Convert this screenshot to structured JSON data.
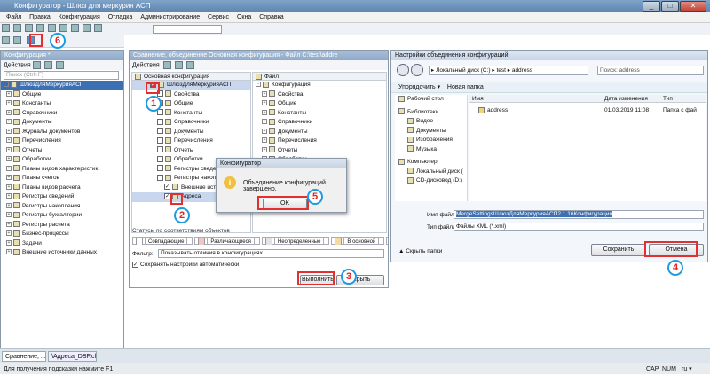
{
  "app": {
    "title": "Конфигуратор - Шлюз для меркурия АСП",
    "win_min": "_",
    "win_max": "□",
    "win_close": "✕"
  },
  "menu": [
    "Файл",
    "Правка",
    "Конфигурация",
    "Отладка",
    "Администрирование",
    "Сервис",
    "Окна",
    "Справка"
  ],
  "left_panel": {
    "title": "Конфигурация *",
    "actions": "Действия",
    "search_placeholder": "Поиск (Ctrl+F)",
    "root": "ШлюзДляМеркурияАСП",
    "items": [
      "Общие",
      "Константы",
      "Справочники",
      "Документы",
      "Журналы документов",
      "Перечисления",
      "Отчеты",
      "Обработки",
      "Планы видов характеристик",
      "Планы счетов",
      "Планы видов расчета",
      "Регистры сведений",
      "Регистры накопления",
      "Регистры бухгалтерии",
      "Регистры расчета",
      "Бизнес-процессы",
      "Задачи",
      "Внешние источники данных"
    ]
  },
  "compare": {
    "title": "Сравнение, объединение Основная конфигурация - Файл C:\\test\\addre",
    "actions": "Действия",
    "col_main": "Основная конфигурация",
    "col_file": "Файл",
    "main_root": "ШлюзДляМеркурияАСП",
    "main_items": [
      "Свойства",
      "Общие",
      "Константы",
      "Справочники",
      "Документы",
      "Перечисления",
      "Отчеты",
      "Обработки",
      "Регистры сведен",
      "Регистры накоп",
      "Внешние ист",
      "Адреса"
    ],
    "file_root": "Конфигурация",
    "file_items": [
      "Свойства",
      "Общие",
      "Константы",
      "Справочники",
      "Документы",
      "Перечисления",
      "Отчеты",
      "Обработки",
      "Регистры сведений",
      "Регистры накоплен"
    ],
    "statuses_label": "Статусы по соответствиям объектов",
    "legend": [
      "Совпадающие",
      "Различающиеся",
      "Неопределенные",
      "В основной",
      "Нет порядок"
    ],
    "legend_colors": [
      "#ffffff",
      "#f1c5c5",
      "#e3e3e3",
      "#f5d9a6",
      "#c9e8c2"
    ],
    "filter_label": "Фильтр:",
    "filter_value": "Показывать отличия в конфигурациях",
    "save_settings": "Сохранять настройки автоматически",
    "execute_btn": "Выполнить",
    "close_btn": "акрыть"
  },
  "msgbox": {
    "title": "Конфигуратор",
    "text": "Объединение конфигураций завершено.",
    "ok": "OK"
  },
  "save_dialog": {
    "title": "Настройки объединения конфигураций",
    "path": [
      "Локальный диск (C:)",
      "test",
      "address"
    ],
    "search_placeholder": "Поиск: address",
    "organize": "Упорядочить ▾",
    "new_folder": "Новая папка",
    "nav": [
      {
        "label": "Рабочий стол",
        "indent": 0
      },
      {
        "label": "Библиотеки",
        "indent": 0
      },
      {
        "label": "Видео",
        "indent": 1
      },
      {
        "label": "Документы",
        "indent": 1
      },
      {
        "label": "Изображения",
        "indent": 1
      },
      {
        "label": "Музыка",
        "indent": 1
      },
      {
        "label": "Компьютер",
        "indent": 0
      },
      {
        "label": "Локальный диск (",
        "indent": 1
      },
      {
        "label": "CD-дисковод (D:)",
        "indent": 1
      }
    ],
    "col_name": "Имя",
    "col_date": "Дата изменения",
    "col_type": "Тип",
    "files": [
      {
        "name": "address",
        "date": "01.03.2019 11:08",
        "type": "Папка с фай"
      }
    ],
    "filename_label": "Имя файла:",
    "filename": "MergeSettingsШлюзДляМеркурияАСП2.1.16Конфигурация",
    "filetype_label": "Тип файла:",
    "filetype": "Файлы XML (*.xml)",
    "hide_folders": "Скрыть папки",
    "save_btn": "Сохранить",
    "cancel_btn": "Отмена"
  },
  "steps": [
    "1",
    "2",
    "3",
    "4",
    "5",
    "6"
  ],
  "taskbar": {
    "tab1": "Сравнение, ...",
    "tab2": "\\Адреса_DBF.cf"
  },
  "status": {
    "hint": "Для получения подсказки нажмите F1",
    "cap": "CAP",
    "num": "NUM",
    "lang": "ru ▾"
  }
}
